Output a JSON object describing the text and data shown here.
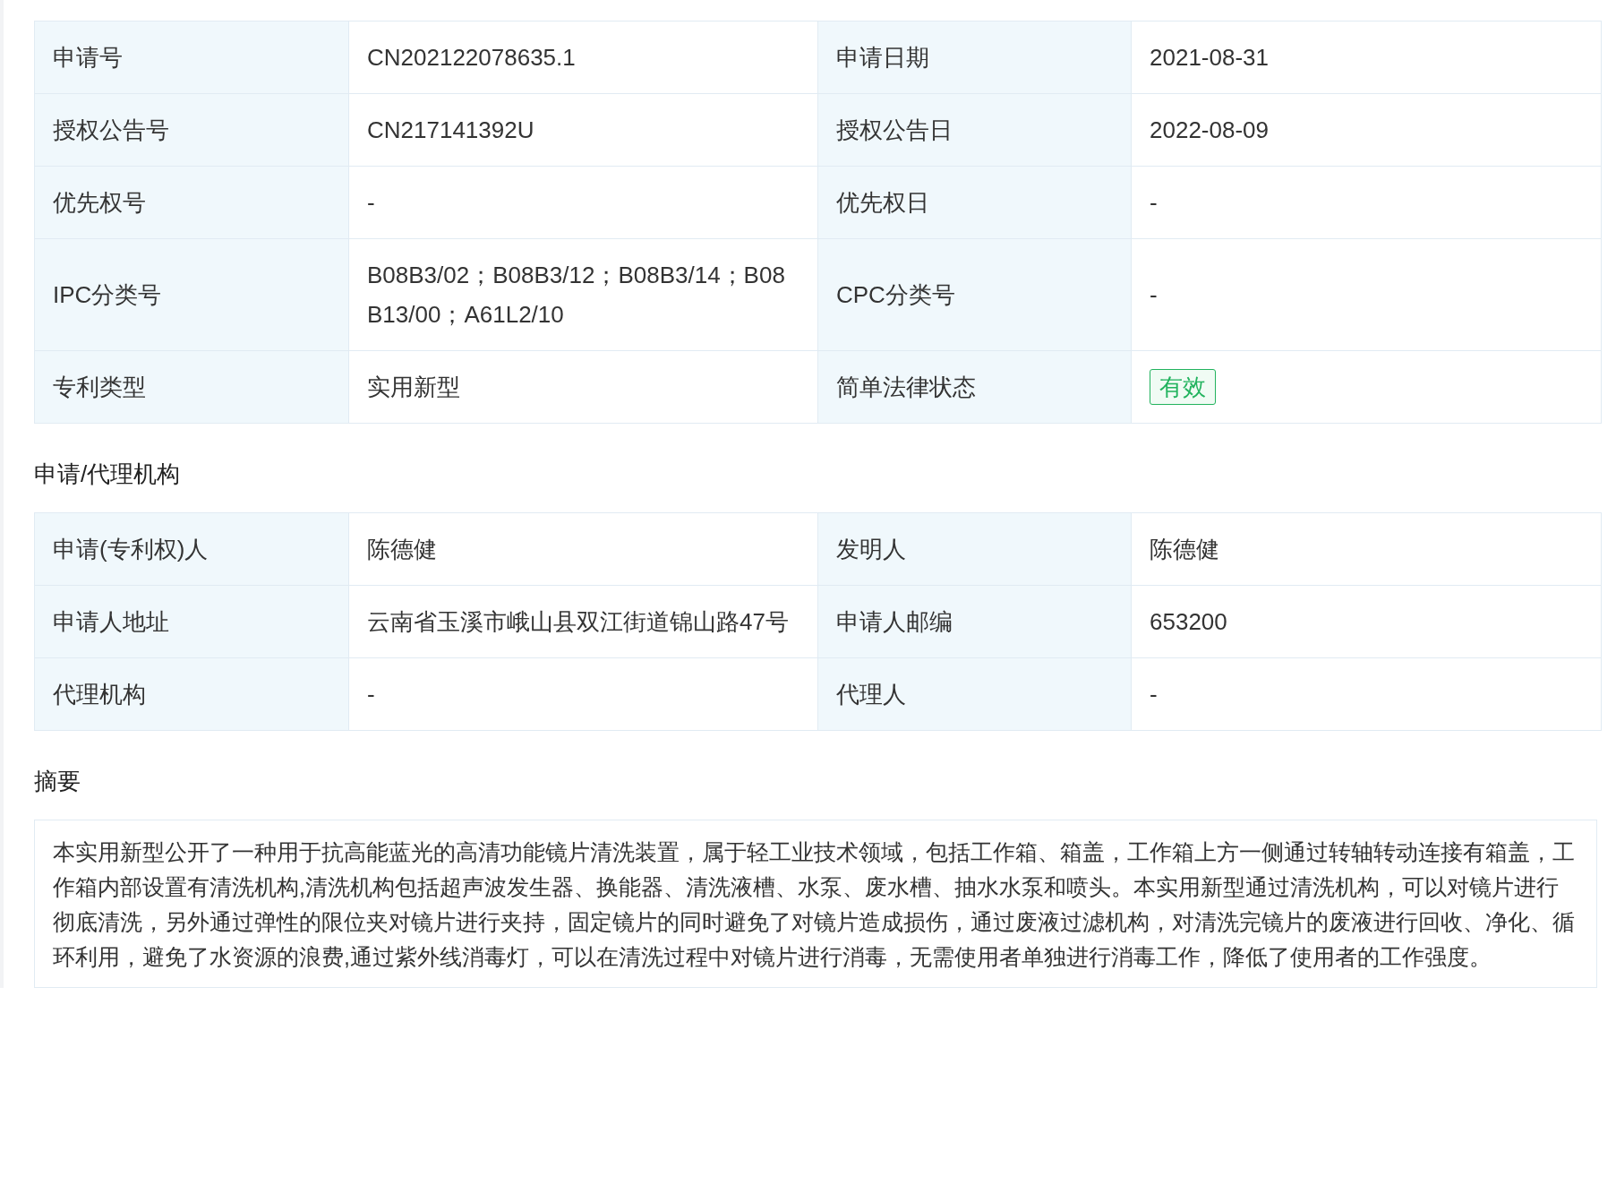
{
  "sections": [
    {
      "rows": [
        {
          "cells": [
            {
              "kind": "label",
              "text": "申请号"
            },
            {
              "kind": "value",
              "text": "CN202122078635.1"
            },
            {
              "kind": "label",
              "text": "申请日期"
            },
            {
              "kind": "value",
              "text": "2021-08-31"
            }
          ]
        },
        {
          "cells": [
            {
              "kind": "label",
              "text": "授权公告号"
            },
            {
              "kind": "value",
              "text": "CN217141392U"
            },
            {
              "kind": "label",
              "text": "授权公告日"
            },
            {
              "kind": "value",
              "text": "2022-08-09"
            }
          ]
        },
        {
          "cells": [
            {
              "kind": "label",
              "text": "优先权号"
            },
            {
              "kind": "value",
              "text": "-"
            },
            {
              "kind": "label",
              "text": "优先权日"
            },
            {
              "kind": "value",
              "text": "-"
            }
          ]
        },
        {
          "cells": [
            {
              "kind": "label",
              "text": "IPC分类号"
            },
            {
              "kind": "value",
              "text": "B08B3/02；B08B3/12；B08B3/14；B08B13/00；A61L2/10"
            },
            {
              "kind": "label",
              "text": "CPC分类号"
            },
            {
              "kind": "value",
              "text": "-"
            }
          ]
        },
        {
          "cells": [
            {
              "kind": "label",
              "text": "专利类型"
            },
            {
              "kind": "value",
              "text": "实用新型"
            },
            {
              "kind": "label",
              "text": "简单法律状态"
            },
            {
              "kind": "status",
              "text": "有效"
            }
          ]
        }
      ]
    },
    {
      "title": "申请/代理机构",
      "rows": [
        {
          "cells": [
            {
              "kind": "label",
              "text": "申请(专利权)人"
            },
            {
              "kind": "value",
              "text": "陈德健"
            },
            {
              "kind": "label",
              "text": "发明人"
            },
            {
              "kind": "value",
              "text": "陈德健"
            }
          ]
        },
        {
          "cells": [
            {
              "kind": "label",
              "text": "申请人地址"
            },
            {
              "kind": "value",
              "text": "云南省玉溪市峨山县双江街道锦山路47号"
            },
            {
              "kind": "label",
              "text": "申请人邮编"
            },
            {
              "kind": "value",
              "text": "653200"
            }
          ]
        },
        {
          "cells": [
            {
              "kind": "label",
              "text": "代理机构"
            },
            {
              "kind": "value",
              "text": "-"
            },
            {
              "kind": "label",
              "text": "代理人"
            },
            {
              "kind": "value",
              "text": "-"
            }
          ]
        }
      ]
    },
    {
      "title": "摘要",
      "abstract": "本实用新型公开了一种用于抗高能蓝光的高清功能镜片清洗装置，属于轻工业技术领域，包括工作箱、箱盖，工作箱上方一侧通过转轴转动连接有箱盖，工作箱内部设置有清洗机构,清洗机构包括超声波发生器、换能器、清洗液槽、水泵、废水槽、抽水水泵和喷头。本实用新型通过清洗机构，可以对镜片进行彻底清洗，另外通过弹性的限位夹对镜片进行夹持，固定镜片的同时避免了对镜片造成损伤，通过废液过滤机构，对清洗完镜片的废液进行回收、净化、循环利用，避免了水资源的浪费,通过紫外线消毒灯，可以在清洗过程中对镜片进行消毒，无需使用者单独进行消毒工作，降低了使用者的工作强度。"
    }
  ]
}
